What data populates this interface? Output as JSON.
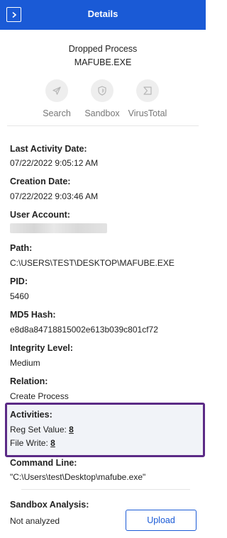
{
  "header": {
    "title": "Details",
    "collapse_icon": "chevron-right-icon"
  },
  "process": {
    "type": "Dropped Process",
    "name": "MAFUBE.EXE"
  },
  "actions": [
    {
      "label": "Search",
      "icon": "paper-plane-icon"
    },
    {
      "label": "Sandbox",
      "icon": "shield-icon"
    },
    {
      "label": "VirusTotal",
      "icon": "virustotal-icon"
    }
  ],
  "fields": {
    "last_activity": {
      "label": "Last Activity Date:",
      "value": "07/22/2022 9:05:12 AM"
    },
    "creation": {
      "label": "Creation Date:",
      "value": "07/22/2022 9:03:46 AM"
    },
    "user_account": {
      "label": "User Account:"
    },
    "path": {
      "label": "Path:",
      "value": "C:\\USERS\\TEST\\DESKTOP\\MAFUBE.EXE"
    },
    "pid": {
      "label": "PID:",
      "value": "5460"
    },
    "md5": {
      "label": "MD5 Hash:",
      "value": "e8d8a84718815002e613b039c801cf72"
    },
    "integrity": {
      "label": "Integrity Level:",
      "value": "Medium"
    },
    "relation": {
      "label": "Relation:",
      "value": "Create Process"
    },
    "command_line": {
      "label": "Command Line:",
      "value": "\"C:\\Users\\test\\Desktop\\mafube.exe\""
    },
    "sandbox_analysis": {
      "label": "Sandbox Analysis:",
      "value": "Not analyzed"
    }
  },
  "activities": {
    "label": "Activities:",
    "items": [
      {
        "label": "Reg Set Value:",
        "count": "8"
      },
      {
        "label": "File Write:",
        "count": "8"
      }
    ]
  },
  "upload_label": "Upload",
  "colors": {
    "header": "#1a5ad6",
    "highlight_border": "#5b2a86",
    "highlight_bg": "#f1f3f8"
  }
}
